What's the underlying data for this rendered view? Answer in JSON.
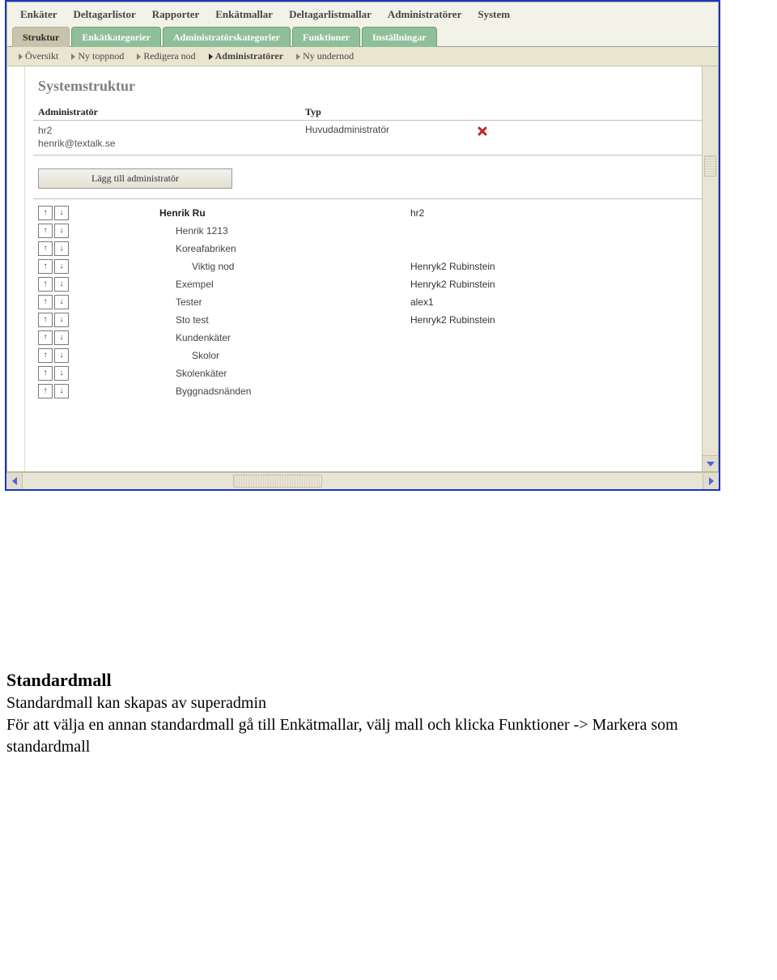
{
  "menubar": [
    "Enkäter",
    "Deltagarlistor",
    "Rapporter",
    "Enkätmallar",
    "Deltagarlistmallar",
    "Administratörer",
    "System"
  ],
  "tabs": [
    {
      "label": "Struktur",
      "active": true
    },
    {
      "label": "Enkätkategorier",
      "active": false
    },
    {
      "label": "Administratörskategorier",
      "active": false
    },
    {
      "label": "Funktioner",
      "active": false
    },
    {
      "label": "Inställningar",
      "active": false
    }
  ],
  "subnav": [
    {
      "label": "Översikt",
      "active": false
    },
    {
      "label": "Ny toppnod",
      "active": false
    },
    {
      "label": "Redigera nod",
      "active": false
    },
    {
      "label": "Administratörer",
      "active": true
    },
    {
      "label": "Ny undernod",
      "active": false
    }
  ],
  "page_title": "Systemstruktur",
  "columns": {
    "c1": "Administratör",
    "c2": "Typ"
  },
  "admin_row": {
    "name": "hr2",
    "email": "henrik@textalk.se",
    "type": "Huvudadministratör"
  },
  "add_button": "Lägg till administratör",
  "nodes": [
    {
      "indent": 1,
      "name": "Henrik Ru",
      "bold": true,
      "owner": "hr2"
    },
    {
      "indent": 2,
      "name": "Henrik 1213",
      "owner": ""
    },
    {
      "indent": 2,
      "name": "Koreafabriken",
      "owner": ""
    },
    {
      "indent": 3,
      "name": "Viktig nod",
      "owner": "Henryk2 Rubinstein"
    },
    {
      "indent": 2,
      "name": "Exempel",
      "owner": "Henryk2 Rubinstein"
    },
    {
      "indent": 2,
      "name": "Tester",
      "owner": "alex1"
    },
    {
      "indent": 2,
      "name": "Sto test",
      "owner": "Henryk2 Rubinstein"
    },
    {
      "indent": 2,
      "name": "Kundenkäter",
      "owner": ""
    },
    {
      "indent": 3,
      "name": "Skolor",
      "owner": ""
    },
    {
      "indent": 2,
      "name": "Skolenkäter",
      "owner": ""
    },
    {
      "indent": 2,
      "name": "Byggnadsnänden",
      "owner": ""
    }
  ],
  "arrow_labels": {
    "up": "↑",
    "down": "↓"
  },
  "doc": {
    "heading": "Standardmall",
    "p1": "Standardmall kan skapas av superadmin",
    "p2": "För att välja en annan standardmall gå till Enkätmallar, välj mall och klicka Funktioner -> Markera som standardmall"
  }
}
